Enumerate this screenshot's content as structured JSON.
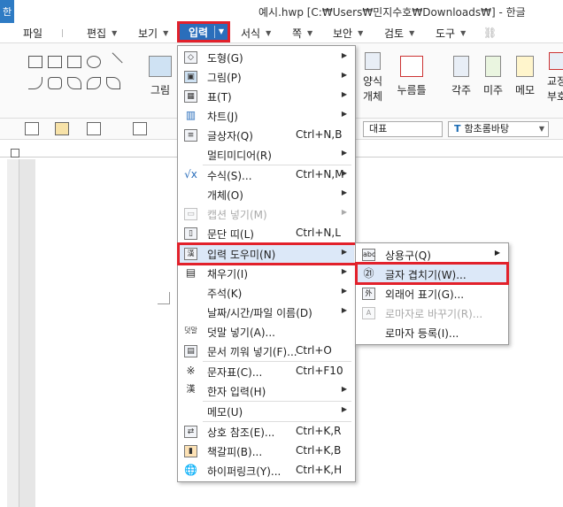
{
  "app": {
    "badge": "한",
    "title": "예시.hwp [C:₩Users₩민지수호₩Downloads₩] - 한글"
  },
  "menubar": {
    "items": [
      {
        "label": "파일"
      },
      {
        "label": "편집"
      },
      {
        "label": "보기"
      },
      {
        "label": "입력"
      },
      {
        "label": "서식"
      },
      {
        "label": "쪽"
      },
      {
        "label": "보안"
      },
      {
        "label": "검토"
      },
      {
        "label": "도구"
      }
    ],
    "active": "입력"
  },
  "ribbon": {
    "picture": "그림",
    "form_object_1": "양식",
    "form_object_2": "개체",
    "button": "누름틀",
    "footnote": "각주",
    "endnote": "미주",
    "memo": "메모",
    "crossref_1": "교정",
    "crossref_2": "부호"
  },
  "toolbar": {
    "style_value": "대표",
    "font_value": "함초롬바탕",
    "font_icon": "T"
  },
  "dropdown": {
    "items": [
      {
        "icon": "shape-icon",
        "label": "도형(G)",
        "shortcut": "",
        "submenu": true
      },
      {
        "icon": "picture-icon",
        "label": "그림(P)",
        "shortcut": "",
        "submenu": true
      },
      {
        "icon": "table-icon",
        "label": "표(T)",
        "shortcut": "",
        "submenu": true
      },
      {
        "icon": "chart-icon",
        "label": "차트(J)",
        "shortcut": "",
        "submenu": true
      },
      {
        "icon": "textbox-icon",
        "label": "글상자(Q)",
        "shortcut": "Ctrl+N,B",
        "submenu": false
      },
      {
        "icon": "",
        "label": "멀티미디어(R)",
        "shortcut": "",
        "submenu": true
      },
      {
        "icon": "formula-icon",
        "label": "수식(S)...",
        "shortcut": "Ctrl+N,M",
        "submenu": true
      },
      {
        "icon": "",
        "label": "개체(O)",
        "shortcut": "",
        "submenu": true
      },
      {
        "icon": "caption-icon",
        "label": "캡션 넣기(M)",
        "shortcut": "",
        "submenu": true,
        "disabled": true
      },
      {
        "icon": "paragraph-band-icon",
        "label": "문단 띠(L)",
        "shortcut": "Ctrl+N,L",
        "submenu": false
      },
      {
        "icon": "input-helper-icon",
        "label": "입력 도우미(N)",
        "shortcut": "",
        "submenu": true,
        "selected": true
      },
      {
        "icon": "fill-icon",
        "label": "채우기(I)",
        "shortcut": "",
        "submenu": true
      },
      {
        "icon": "",
        "label": "주석(K)",
        "shortcut": "",
        "submenu": true
      },
      {
        "icon": "",
        "label": "날짜/시간/파일 이름(D)",
        "shortcut": "",
        "submenu": true
      },
      {
        "icon": "dutmal-icon",
        "label": "덧말 넣기(A)...",
        "shortcut": "",
        "submenu": false
      },
      {
        "icon": "insert-doc-icon",
        "label": "문서 끼워 넣기(F)...",
        "shortcut": "Ctrl+O",
        "submenu": false
      },
      {
        "icon": "symbol-icon",
        "label": "문자표(C)...",
        "shortcut": "Ctrl+F10",
        "submenu": false
      },
      {
        "icon": "hanja-icon",
        "label": "한자 입력(H)",
        "shortcut": "",
        "submenu": true
      },
      {
        "icon": "",
        "label": "메모(U)",
        "shortcut": "",
        "submenu": true
      },
      {
        "icon": "crossref-icon",
        "label": "상호 참조(E)...",
        "shortcut": "Ctrl+K,R",
        "submenu": false
      },
      {
        "icon": "bookmark-icon",
        "label": "책갈피(B)...",
        "shortcut": "Ctrl+K,B",
        "submenu": false
      },
      {
        "icon": "hyperlink-icon",
        "label": "하이퍼링크(Y)...",
        "shortcut": "Ctrl+K,H",
        "submenu": false
      }
    ]
  },
  "submenu": {
    "items": [
      {
        "icon": "common-phrase-icon",
        "label": "상용구(Q)",
        "submenu": true
      },
      {
        "icon": "overlap-char-icon",
        "label": "글자 겹치기(W)...",
        "selected": true
      },
      {
        "icon": "foreign-word-icon",
        "label": "외래어 표기(G)..."
      },
      {
        "icon": "romanize-icon",
        "label": "로마자로 바꾸기(R)...",
        "disabled": true
      },
      {
        "icon": "",
        "label": "로마자 등록(I)..."
      }
    ]
  },
  "glyphs": {
    "circled21": "㉑",
    "kangxi": "※",
    "submenu_arrow": "▶",
    "caret": "▼"
  }
}
